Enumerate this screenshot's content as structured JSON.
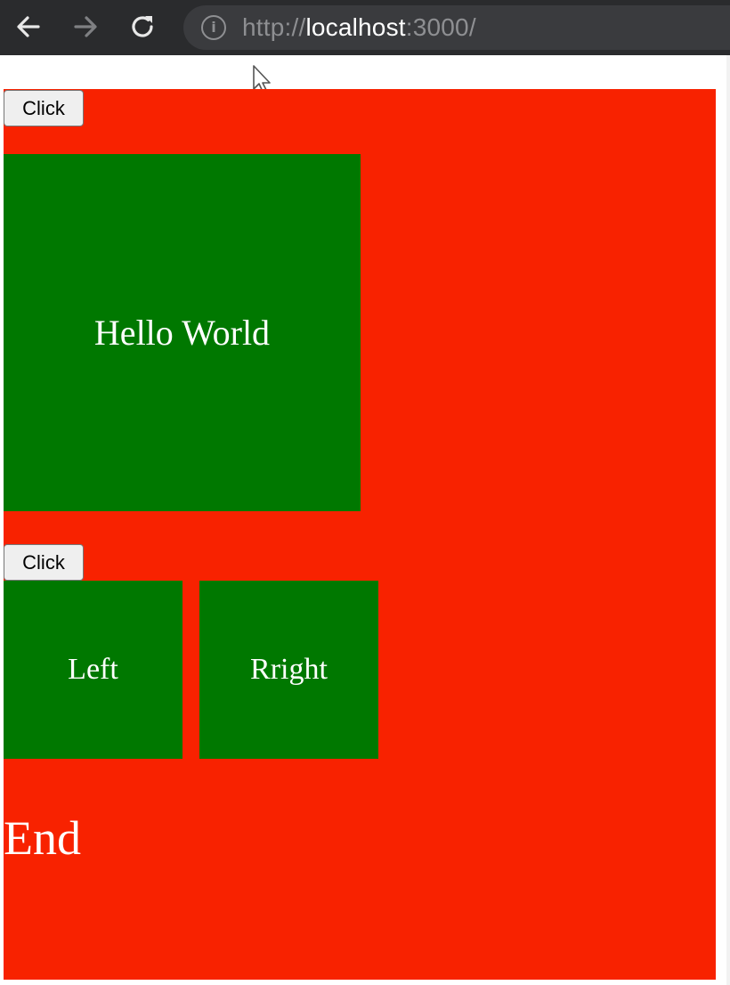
{
  "browser": {
    "url_scheme": "http://",
    "url_host": "localhost",
    "url_port_path": ":3000/",
    "info_icon_glyph": "i"
  },
  "page": {
    "top_button_label": "Click",
    "hello_box_text": "Hello World",
    "second_button_label": "Click",
    "left_box_text": "Left",
    "right_box_text": "Rright",
    "end_text": "End"
  },
  "colors": {
    "page_background": "#f82200",
    "box_background": "#007800",
    "toolbar_background": "#2a2b2d"
  }
}
